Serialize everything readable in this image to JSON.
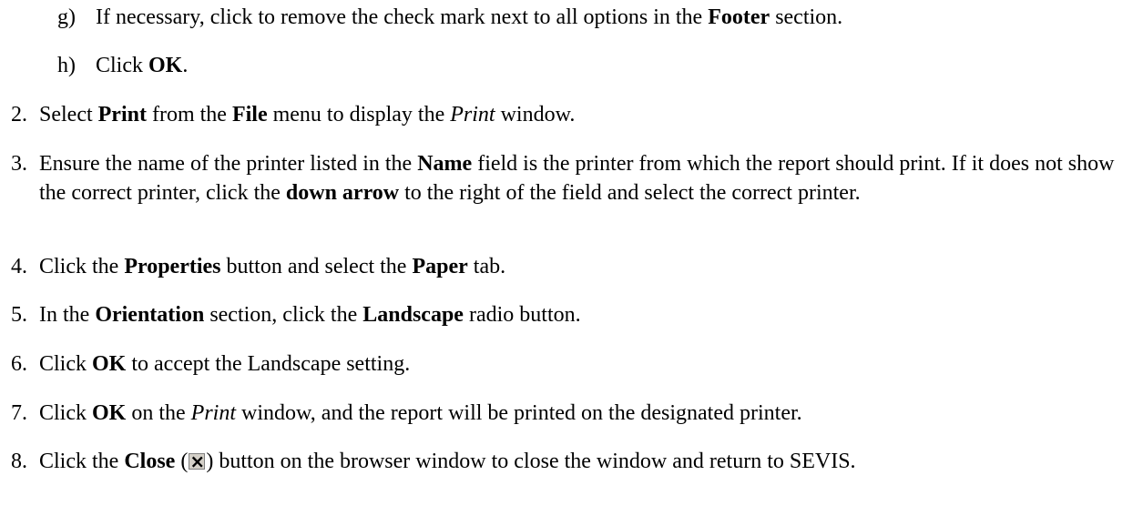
{
  "steps": [
    {
      "marker": "g)",
      "parts": [
        {
          "t": "If necessary, click to remove the check mark next to all options in the "
        },
        {
          "t": "Footer",
          "b": true
        },
        {
          "t": " section."
        }
      ]
    },
    {
      "marker": "h)",
      "parts": [
        {
          "t": "Click "
        },
        {
          "t": "OK",
          "b": true
        },
        {
          "t": "."
        }
      ]
    },
    {
      "marker": "2.",
      "parts": [
        {
          "t": "Select "
        },
        {
          "t": "Print",
          "b": true
        },
        {
          "t": " from the "
        },
        {
          "t": "File",
          "b": true
        },
        {
          "t": " menu to display the "
        },
        {
          "t": "Print",
          "i": true
        },
        {
          "t": " window."
        }
      ]
    },
    {
      "marker": "3.",
      "parts": [
        {
          "t": "Ensure the name of the printer listed in the "
        },
        {
          "t": "Name",
          "b": true
        },
        {
          "t": " field is the printer from which the report should print.  If it does not show the correct printer, click the "
        },
        {
          "t": "down arrow",
          "b": true
        },
        {
          "t": " to the right of the field and select the correct printer."
        }
      ]
    },
    {
      "marker": "4.",
      "parts": [
        {
          "t": "Click the "
        },
        {
          "t": "Properties",
          "b": true
        },
        {
          "t": " button and select the "
        },
        {
          "t": "Paper",
          "b": true
        },
        {
          "t": " tab."
        }
      ]
    },
    {
      "marker": "5.",
      "parts": [
        {
          "t": "In the "
        },
        {
          "t": "Orientation",
          "b": true
        },
        {
          "t": " section, click the "
        },
        {
          "t": "Landscape",
          "b": true
        },
        {
          "t": " radio button."
        }
      ]
    },
    {
      "marker": "6.",
      "parts": [
        {
          "t": "Click "
        },
        {
          "t": "OK",
          "b": true
        },
        {
          "t": " to accept the Landscape setting."
        }
      ]
    },
    {
      "marker": "7.",
      "parts": [
        {
          "t": "Click "
        },
        {
          "t": "OK",
          "b": true
        },
        {
          "t": " on the "
        },
        {
          "t": "Print",
          "i": true
        },
        {
          "t": " window, and the report will be printed on the designated printer."
        }
      ]
    },
    {
      "marker": "8.",
      "parts": [
        {
          "t": "Click the "
        },
        {
          "t": "Close",
          "b": true
        },
        {
          "t": " ("
        },
        {
          "icon": "close-icon"
        },
        {
          "t": ") button on the browser window to close the window and return to SEVIS."
        }
      ]
    }
  ]
}
